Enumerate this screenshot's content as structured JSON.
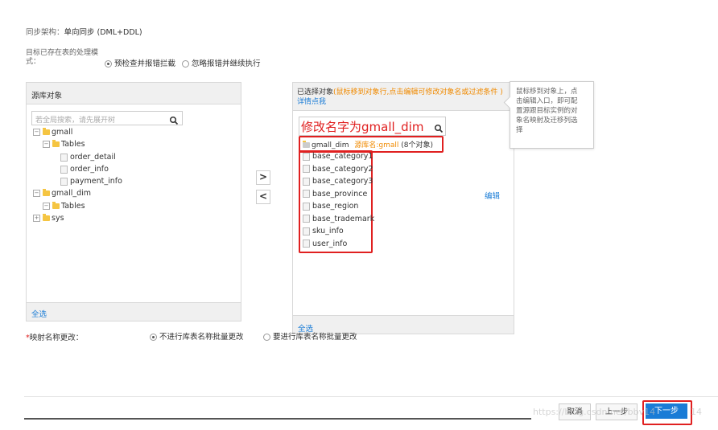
{
  "header": {
    "sync_arch_label": "同步架构：",
    "sync_arch_value": "单向同步 (DML+DDL)",
    "exist_table_label_l1": "目标已存在表的处理模",
    "exist_table_label_l2": "式：",
    "option_precheck": "预检查并报错拦截",
    "option_ignore": "忽略报错并继续执行"
  },
  "source_panel": {
    "title": "源库对象",
    "search_placeholder": "若全局搜索，请先展开树",
    "tree": {
      "db1": "gmall",
      "db1_tables": "Tables",
      "t1": "order_detail",
      "t2": "order_info",
      "t3": "payment_info",
      "db2": "gmall_dim",
      "db2_tables": "Tables",
      "db3": "sys"
    },
    "select_all": "全选"
  },
  "transfer": {
    "move_right": ">",
    "move_left": "<"
  },
  "target_panel": {
    "title": "已选择对象",
    "hint": "(鼠标移到对象行,点击编辑可修改对象名或过滤条件 )",
    "detail_link": "详情点我",
    "annotation": "修改名字为gmall_dim",
    "db_name": "gmall_dim",
    "source_db_label": "源库名:gmall",
    "object_count": "(8个对象)",
    "tables": [
      "base_category1",
      "base_category2",
      "base_category3",
      "base_province",
      "base_region",
      "base_trademark",
      "sku_info",
      "user_info"
    ],
    "edit_label": "编辑",
    "select_all": "全选"
  },
  "tooltip": {
    "text_lines": [
      "鼠标移到对象上，点",
      "击编辑入口，即可配",
      "置源跟目标实例的对",
      "象名映射及迁移列选",
      "择"
    ]
  },
  "mapping": {
    "label": "映射名称更改：",
    "required_mark": "*",
    "option_no": "不进行库表名称批量更改",
    "option_yes": "要进行库表名称批量更改"
  },
  "footer": {
    "cancel": "取消",
    "prev": "上一步",
    "next": "下一步",
    "watermark": "https://blog.csdn.net/bbv14",
    "watermark_2": "14"
  },
  "icons": {
    "search": "search-icon",
    "folder": "folder-icon",
    "table": "table-icon",
    "db": "database-icon"
  },
  "colors": {
    "accent": "#1a7cd6",
    "orange": "#f08a00",
    "red_annotation": "#e02020",
    "primary_button": "#1a7cd6"
  }
}
